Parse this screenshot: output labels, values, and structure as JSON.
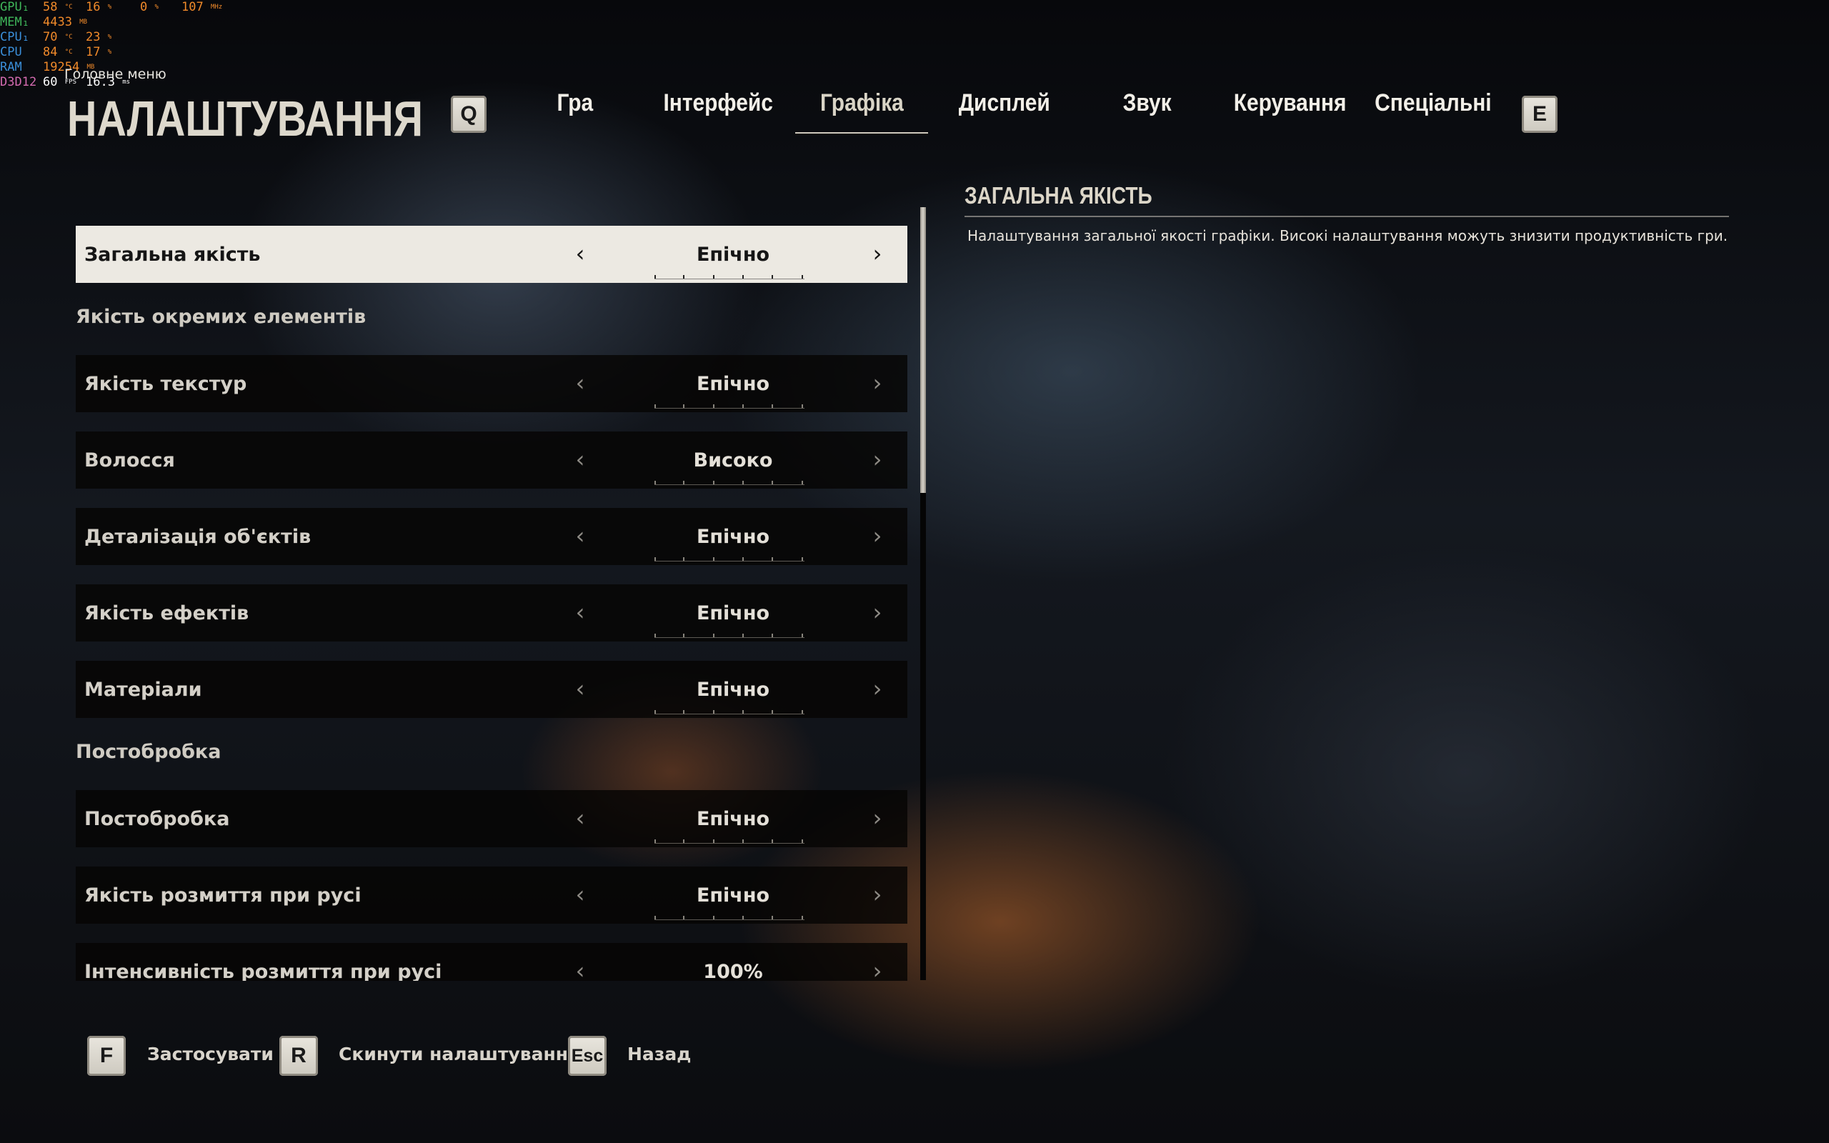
{
  "perf_overlay": [
    {
      "label": "GPU₁",
      "v1": "58",
      "u1": "°C",
      "v2": "16",
      "u2": "%",
      "v3": "0",
      "u3": "%",
      "v4": "107",
      "u4": "MHz",
      "color": "#3fb65a"
    },
    {
      "label": "MEM₁",
      "v1": "4433",
      "u1": "MB",
      "color": "#3fb65a"
    },
    {
      "label": "CPU₁",
      "v1": "70",
      "u1": "°C",
      "v2": "23",
      "u2": "%",
      "color": "#3a8ed8"
    },
    {
      "label": "CPU",
      "v1": "84",
      "u1": "°C",
      "v2": "17",
      "u2": "%",
      "color": "#3a8ed8"
    },
    {
      "label": "RAM",
      "v1": "19254",
      "u1": "MB",
      "color": "#3a8ed8"
    },
    {
      "label": "D3D12",
      "v1": "60",
      "u1": "FPS",
      "v2": "16.3",
      "u2": "ms",
      "color": "#d46bb0"
    }
  ],
  "breadcrumb": "Головне меню",
  "title": "НАЛАШТУВАННЯ",
  "keys": {
    "prev_tab": "Q",
    "next_tab": "E"
  },
  "tabs": [
    {
      "label": "Гра",
      "active": false
    },
    {
      "label": "Інтерфейс",
      "active": false
    },
    {
      "label": "Графіка",
      "active": true
    },
    {
      "label": "Дисплей",
      "active": false
    },
    {
      "label": "Звук",
      "active": false
    },
    {
      "label": "Керування",
      "active": false
    },
    {
      "label": "Спеціальні",
      "active": false
    }
  ],
  "settings": [
    {
      "type": "row",
      "label": "Загальна якість",
      "value": "Епічно",
      "selected": true
    },
    {
      "type": "section",
      "label": "Якість окремих елементів"
    },
    {
      "type": "row",
      "label": "Якість текстур",
      "value": "Епічно"
    },
    {
      "type": "row",
      "label": "Волосся",
      "value": "Високо"
    },
    {
      "type": "row",
      "label": "Деталізація об'єктів",
      "value": "Епічно"
    },
    {
      "type": "row",
      "label": "Якість ефектів",
      "value": "Епічно"
    },
    {
      "type": "row",
      "label": "Матеріали",
      "value": "Епічно"
    },
    {
      "type": "section",
      "label": "Постобробка"
    },
    {
      "type": "row",
      "label": "Постобробка",
      "value": "Епічно"
    },
    {
      "type": "row",
      "label": "Якість розмиття при русі",
      "value": "Епічно"
    },
    {
      "type": "row",
      "label": "Інтенсивність розмиття при русі",
      "value": "100%"
    }
  ],
  "arrows": {
    "left": "‹",
    "right": "›"
  },
  "description": {
    "title": "ЗАГАЛЬНА ЯКІСТЬ",
    "text": "Налаштування загальної якості графіки. Високі налаштування можуть знизити продуктивність гри."
  },
  "footer": [
    {
      "key": "F",
      "label": "Застосувати"
    },
    {
      "key": "R",
      "label": "Скинути налаштування"
    },
    {
      "key": "Esc",
      "label": "Назад"
    }
  ]
}
